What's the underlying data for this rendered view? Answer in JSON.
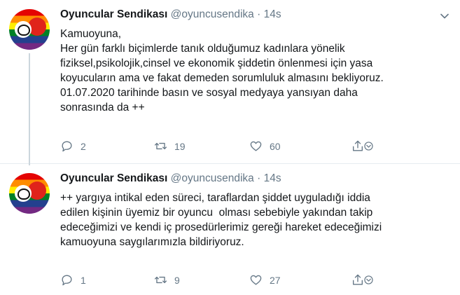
{
  "tweets": [
    {
      "author": "Oyuncular Sendikası",
      "handle": "@oyuncusendika",
      "separator": "·",
      "time": "14s",
      "lines": [
        "Kamuoyuna,",
        "Her gün farklı biçimlerde tanık olduğumuz kadınlara yönelik",
        "fiziksel,psikolojik,cinsel ve ekonomik şiddetin önlenmesi için yasa",
        "koyucuların ama ve fakat demeden sorumluluk almasını bekliyoruz.",
        "01.07.2020 tarihinde basın ve sosyal medyaya yansıyan daha",
        "sonrasında da ++"
      ],
      "replies": "2",
      "retweets": "19",
      "likes": "60"
    },
    {
      "author": "Oyuncular Sendikası",
      "handle": "@oyuncusendika",
      "separator": "·",
      "time": "14s",
      "lines": [
        "++ yargıya intikal eden süreci, taraflardan şiddet uyguladığı iddia",
        "edilen kişinin üyemiz bir oyuncu  olması sebebiyle yakından takip",
        "edeceğimizi ve kendi iç prosedürlerimiz gereği hareket edeceğimizi",
        "kamuoyuna saygılarımızla bildiriyoruz."
      ],
      "replies": "1",
      "retweets": "9",
      "likes": "27"
    }
  ],
  "icons": {
    "reply": "reply-icon",
    "retweet": "retweet-icon",
    "like": "heart-icon",
    "share": "share-icon",
    "caret": "chevron-down-icon"
  },
  "colors": {
    "text": "#14171a",
    "secondary": "#657786",
    "divider": "#e6ecf0",
    "thread_line": "#ccd6dd"
  }
}
